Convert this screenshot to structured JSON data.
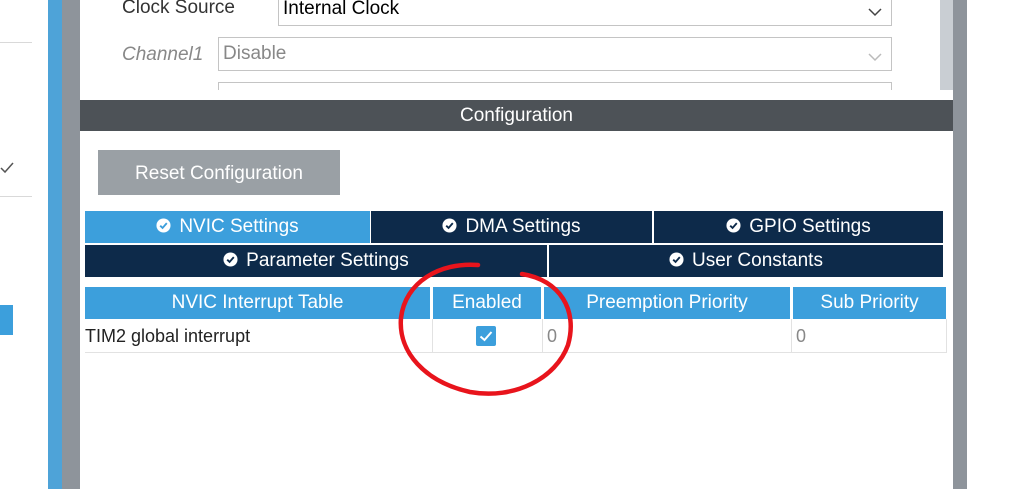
{
  "top": {
    "clock_source_label": "Clock Source",
    "clock_source_value": "Internal Clock",
    "channel1_label": "Channel1",
    "channel1_value": "Disable"
  },
  "config": {
    "header": "Configuration",
    "reset_button": "Reset Configuration",
    "tabs_row1": [
      {
        "label": "NVIC Settings",
        "active": true
      },
      {
        "label": "DMA Settings",
        "active": false
      },
      {
        "label": "GPIO Settings",
        "active": false
      }
    ],
    "tabs_row2": [
      {
        "label": "Parameter Settings",
        "active": false
      },
      {
        "label": "User Constants",
        "active": false
      }
    ],
    "table": {
      "headers": [
        "NVIC Interrupt Table",
        "Enabled",
        "Preemption Priority",
        "Sub Priority"
      ],
      "rows": [
        {
          "name": "TIM2 global interrupt",
          "enabled": true,
          "preemption": "0",
          "sub": "0"
        }
      ]
    }
  },
  "icons": [
    "check-circle-icon",
    "chevron-down-icon",
    "checkmark-icon"
  ],
  "colors": {
    "accent_blue": "#3c9fdc",
    "navy_tab": "#0d2a4a",
    "header_gray": "#4d5257",
    "annotation_red": "#e8141c"
  }
}
